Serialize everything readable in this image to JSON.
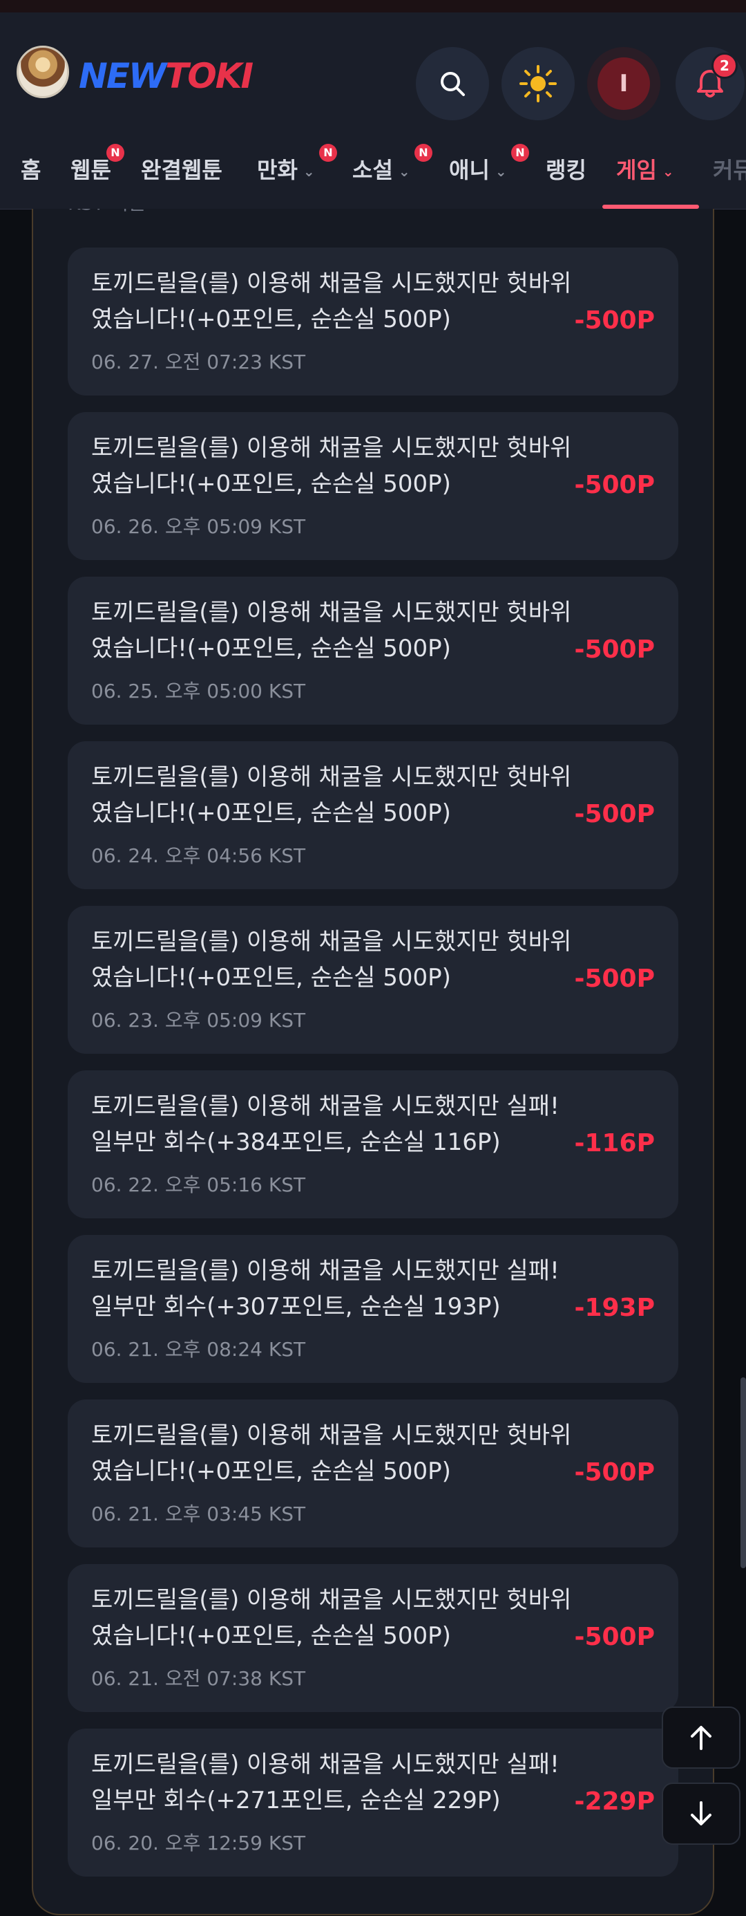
{
  "header": {
    "logo_part1": "NEW",
    "logo_part2": "TOKI",
    "user_initial": "I",
    "notification_count": "2"
  },
  "nav": {
    "items": [
      {
        "label": "홈"
      },
      {
        "label": "웹툰",
        "badge": "N"
      },
      {
        "label": "완결웹툰"
      },
      {
        "label": "만화",
        "badge": "N"
      },
      {
        "label": "소설",
        "badge": "N"
      },
      {
        "label": "애니",
        "badge": "N"
      },
      {
        "label": "랭킹"
      },
      {
        "label": "게임"
      },
      {
        "label": "커뮤"
      }
    ]
  },
  "panel": {
    "top_text": "KST 기준"
  },
  "logs": [
    {
      "desc": "토끼드릴을(를) 이용해 채굴을 시도했지만 헛바위였습니다!(+0포인트, 순손실 500P)",
      "time": "06. 27. 오전 07:23 KST",
      "amount": "-500P"
    },
    {
      "desc": "토끼드릴을(를) 이용해 채굴을 시도했지만 헛바위였습니다!(+0포인트, 순손실 500P)",
      "time": "06. 26. 오후 05:09 KST",
      "amount": "-500P"
    },
    {
      "desc": "토끼드릴을(를) 이용해 채굴을 시도했지만 헛바위였습니다!(+0포인트, 순손실 500P)",
      "time": "06. 25. 오후 05:00 KST",
      "amount": "-500P"
    },
    {
      "desc": "토끼드릴을(를) 이용해 채굴을 시도했지만 헛바위였습니다!(+0포인트, 순손실 500P)",
      "time": "06. 24. 오후 04:56 KST",
      "amount": "-500P"
    },
    {
      "desc": "토끼드릴을(를) 이용해 채굴을 시도했지만 헛바위였습니다!(+0포인트, 순손실 500P)",
      "time": "06. 23. 오후 05:09 KST",
      "amount": "-500P"
    },
    {
      "desc": "토끼드릴을(를) 이용해 채굴을 시도했지만 실패! 일부만 회수(+384포인트, 순손실 116P)",
      "time": "06. 22. 오후 05:16 KST",
      "amount": "-116P"
    },
    {
      "desc": "토끼드릴을(를) 이용해 채굴을 시도했지만 실패! 일부만 회수(+307포인트, 순손실 193P)",
      "time": "06. 21. 오후 08:24 KST",
      "amount": "-193P"
    },
    {
      "desc": "토끼드릴을(를) 이용해 채굴을 시도했지만 헛바위였습니다!(+0포인트, 순손실 500P)",
      "time": "06. 21. 오후 03:45 KST",
      "amount": "-500P"
    },
    {
      "desc": "토끼드릴을(를) 이용해 채굴을 시도했지만 헛바위였습니다!(+0포인트, 순손실 500P)",
      "time": "06. 21. 오전 07:38 KST",
      "amount": "-500P"
    },
    {
      "desc": "토끼드릴을(를) 이용해 채굴을 시도했지만 실패! 일부만 회수(+271포인트, 순손실 229P)",
      "time": "06. 20. 오후 12:59 KST",
      "amount": "-229P"
    }
  ],
  "colors": {
    "accent": "#ff5a72",
    "loss": "#ff2f4a",
    "badge": "#e8324a"
  }
}
